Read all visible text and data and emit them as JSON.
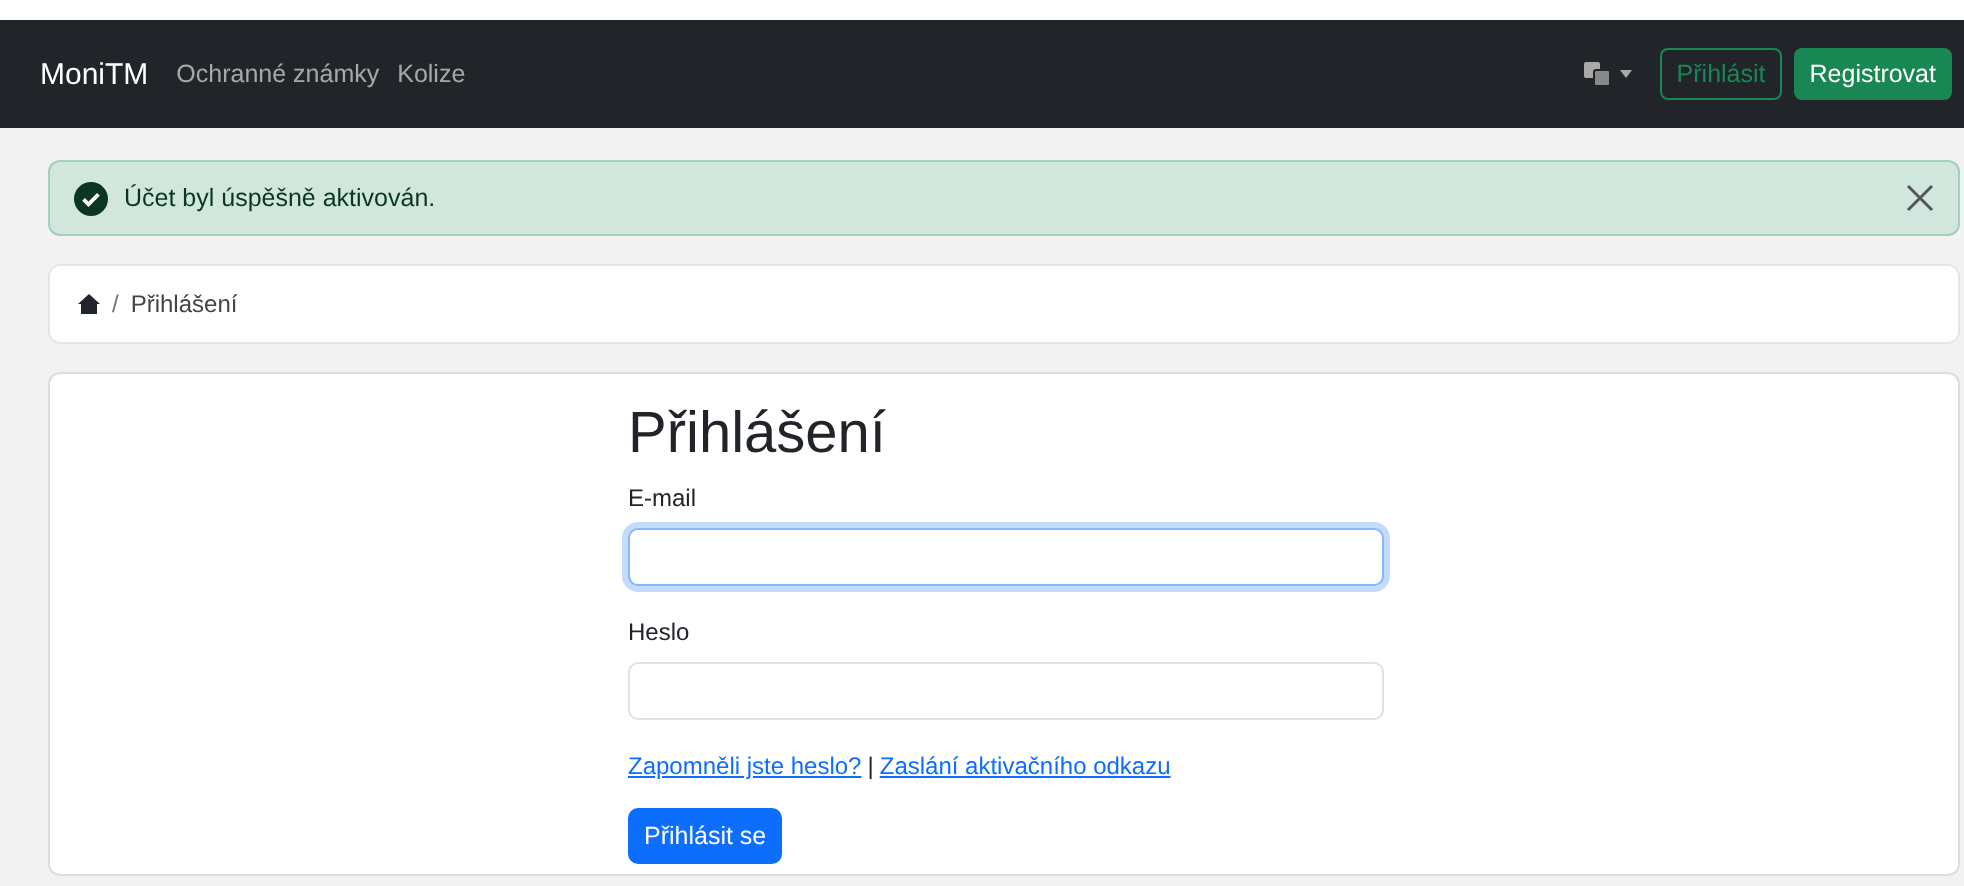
{
  "navbar": {
    "brand": "MoniTM",
    "links": [
      "Ochranné známky",
      "Kolize"
    ],
    "login_button": "Přihlásit",
    "register_button": "Registrovat"
  },
  "alert": {
    "message": "Účet byl úspěšně aktivován."
  },
  "breadcrumb": {
    "separator": "/",
    "current": "Přihlášení"
  },
  "form": {
    "title": "Přihlášení",
    "fields": [
      {
        "label": "E-mail",
        "focused": true
      },
      {
        "label": "Heslo",
        "focused": false
      }
    ],
    "links": [
      "Zapomněli jste heslo?",
      "Zaslání aktivačního odkazu"
    ],
    "separator": "|",
    "submit": "Přihlásit se"
  }
}
